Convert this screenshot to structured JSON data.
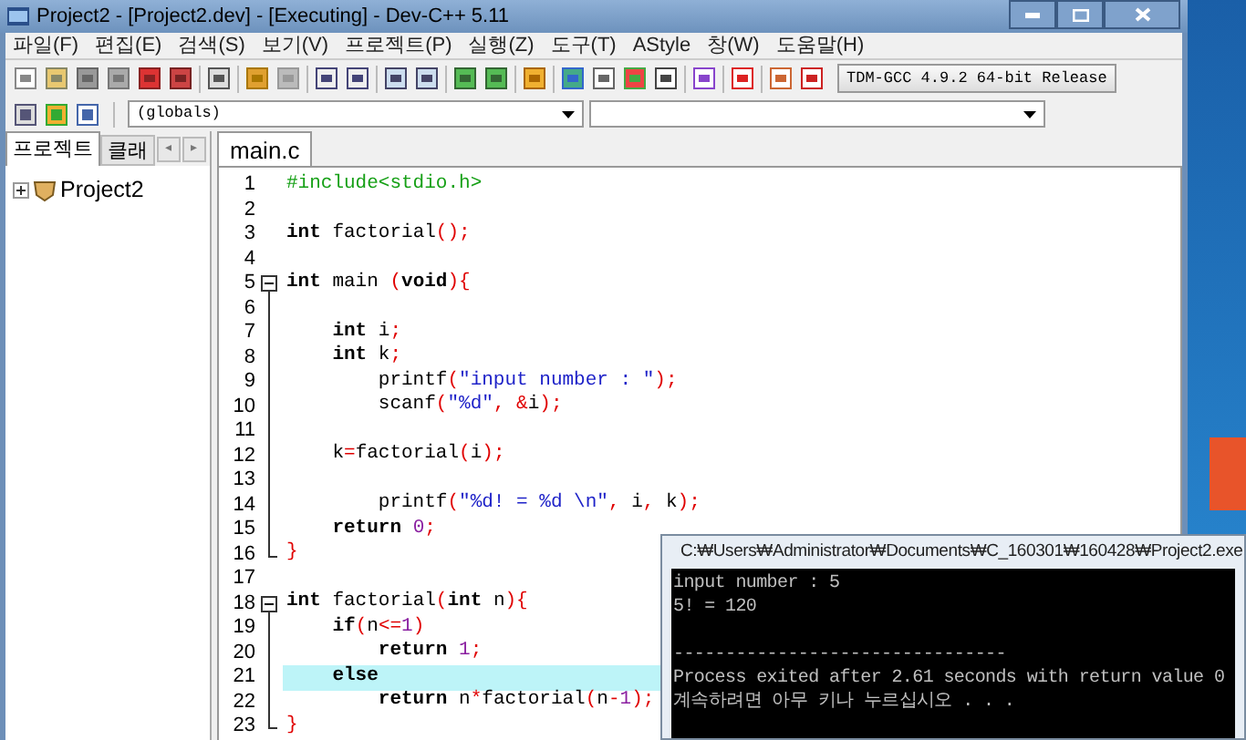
{
  "window": {
    "title": "Project2 - [Project2.dev] - [Executing] - Dev-C++ 5.11"
  },
  "menu": [
    "파일(F)",
    "편집(E)",
    "검색(S)",
    "보기(V)",
    "프로젝트(P)",
    "실행(Z)",
    "도구(T)",
    "AStyle",
    "창(W)",
    "도움말(H)"
  ],
  "compiler": {
    "value": "TDM-GCC 4.9.2 64-bit Release"
  },
  "scope": {
    "value": "(globals)"
  },
  "left_tabs": [
    {
      "label": "프로젝트",
      "selected": true
    },
    {
      "label": "클래",
      "selected": false
    }
  ],
  "left_tab_arrows": [
    "◂",
    "▸"
  ],
  "project_tree": [
    {
      "label": "Project2",
      "expanded": false
    }
  ],
  "editor_tabs": [
    {
      "label": "main.c",
      "selected": true
    }
  ],
  "code_lines": [
    {
      "number": "1",
      "kind": "plain",
      "highlighted": false,
      "tokens": [
        {
          "kind": "preproc",
          "text": "#include<stdio.h>"
        }
      ]
    },
    {
      "number": "2",
      "kind": "plain",
      "highlighted": false
    },
    {
      "number": "3",
      "kind": "plain",
      "highlighted": false,
      "tokens": [
        {
          "kind": "keyword",
          "text": "int"
        },
        {
          "kind": "plain",
          "text": " factorial"
        },
        {
          "kind": "symbol",
          "text": "();"
        }
      ]
    },
    {
      "number": "4",
      "kind": "plain",
      "highlighted": false
    },
    {
      "number": "5",
      "kind": "fold_start",
      "highlighted": false,
      "tokens": [
        {
          "kind": "keyword",
          "text": "int"
        },
        {
          "kind": "plain",
          "text": " main "
        },
        {
          "kind": "symbol",
          "text": "("
        },
        {
          "kind": "keyword",
          "text": "void"
        },
        {
          "kind": "symbol",
          "text": "){"
        }
      ]
    },
    {
      "number": "6",
      "kind": "fold_body",
      "highlighted": false
    },
    {
      "number": "7",
      "kind": "fold_body",
      "highlighted": false,
      "tokens": [
        {
          "kind": "keyword",
          "text": "    int"
        },
        {
          "kind": "plain",
          "text": " i"
        },
        {
          "kind": "symbol",
          "text": ";"
        }
      ]
    },
    {
      "number": "8",
      "kind": "fold_body",
      "highlighted": false,
      "tokens": [
        {
          "kind": "keyword",
          "text": "    int"
        },
        {
          "kind": "plain",
          "text": " k"
        },
        {
          "kind": "symbol",
          "text": ";"
        }
      ]
    },
    {
      "number": "9",
      "kind": "fold_body",
      "highlighted": false,
      "tokens": [
        {
          "kind": "plain",
          "text": "        printf"
        },
        {
          "kind": "symbol",
          "text": "("
        },
        {
          "kind": "string",
          "text": "\"input number : \""
        },
        {
          "kind": "symbol",
          "text": ");"
        }
      ]
    },
    {
      "number": "10",
      "kind": "fold_body",
      "highlighted": false,
      "tokens": [
        {
          "kind": "plain",
          "text": "        scanf"
        },
        {
          "kind": "symbol",
          "text": "("
        },
        {
          "kind": "string",
          "text": "\"%d\""
        },
        {
          "kind": "symbol",
          "text": ", &"
        },
        {
          "kind": "plain",
          "text": "i"
        },
        {
          "kind": "symbol",
          "text": ");"
        }
      ]
    },
    {
      "number": "11",
      "kind": "fold_body",
      "highlighted": false
    },
    {
      "number": "12",
      "kind": "fold_body",
      "highlighted": false,
      "tokens": [
        {
          "kind": "plain",
          "text": "    k"
        },
        {
          "kind": "symbol",
          "text": "="
        },
        {
          "kind": "plain",
          "text": "factorial"
        },
        {
          "kind": "symbol",
          "text": "("
        },
        {
          "kind": "plain",
          "text": "i"
        },
        {
          "kind": "symbol",
          "text": ");"
        }
      ]
    },
    {
      "number": "13",
      "kind": "fold_body",
      "highlighted": false
    },
    {
      "number": "14",
      "kind": "fold_body",
      "highlighted": false,
      "tokens": [
        {
          "kind": "plain",
          "text": "        printf"
        },
        {
          "kind": "symbol",
          "text": "("
        },
        {
          "kind": "string",
          "text": "\"%d! = %d \\n\""
        },
        {
          "kind": "symbol",
          "text": ", "
        },
        {
          "kind": "plain",
          "text": "i"
        },
        {
          "kind": "symbol",
          "text": ", "
        },
        {
          "kind": "plain",
          "text": "k"
        },
        {
          "kind": "symbol",
          "text": ");"
        }
      ]
    },
    {
      "number": "15",
      "kind": "fold_body",
      "highlighted": false,
      "tokens": [
        {
          "kind": "keyword",
          "text": "    return"
        },
        {
          "kind": "number",
          "text": " 0"
        },
        {
          "kind": "symbol",
          "text": ";"
        }
      ]
    },
    {
      "number": "16",
      "kind": "fold_end",
      "highlighted": false,
      "tokens": [
        {
          "kind": "symbol",
          "text": "}"
        }
      ]
    },
    {
      "number": "17",
      "kind": "plain",
      "highlighted": false
    },
    {
      "number": "18",
      "kind": "fold_start",
      "highlighted": false,
      "tokens": [
        {
          "kind": "keyword",
          "text": "int"
        },
        {
          "kind": "plain",
          "text": " factorial"
        },
        {
          "kind": "symbol",
          "text": "("
        },
        {
          "kind": "keyword",
          "text": "int"
        },
        {
          "kind": "plain",
          "text": " n"
        },
        {
          "kind": "symbol",
          "text": "){"
        }
      ]
    },
    {
      "number": "19",
      "kind": "fold_body",
      "highlighted": false,
      "tokens": [
        {
          "kind": "keyword",
          "text": "    if"
        },
        {
          "kind": "symbol",
          "text": "("
        },
        {
          "kind": "plain",
          "text": "n"
        },
        {
          "kind": "symbol",
          "text": "<="
        },
        {
          "kind": "number",
          "text": "1"
        },
        {
          "kind": "symbol",
          "text": ")"
        }
      ]
    },
    {
      "number": "20",
      "kind": "fold_body",
      "highlighted": false,
      "tokens": [
        {
          "kind": "keyword",
          "text": "        return"
        },
        {
          "kind": "number",
          "text": " 1"
        },
        {
          "kind": "symbol",
          "text": ";"
        }
      ]
    },
    {
      "number": "21",
      "kind": "fold_body",
      "highlighted": true,
      "tokens": [
        {
          "kind": "keyword",
          "text": "    else"
        }
      ]
    },
    {
      "number": "22",
      "kind": "fold_body",
      "highlighted": false,
      "tokens": [
        {
          "kind": "keyword",
          "text": "        return"
        },
        {
          "kind": "plain",
          "text": " n"
        },
        {
          "kind": "symbol",
          "text": "*"
        },
        {
          "kind": "plain",
          "text": "factorial"
        },
        {
          "kind": "symbol",
          "text": "("
        },
        {
          "kind": "plain",
          "text": "n"
        },
        {
          "kind": "symbol",
          "text": "-"
        },
        {
          "kind": "number",
          "text": "1"
        },
        {
          "kind": "symbol",
          "text": ");"
        }
      ]
    },
    {
      "number": "23",
      "kind": "fold_end",
      "highlighted": false,
      "tokens": [
        {
          "kind": "symbol",
          "text": "}"
        }
      ]
    }
  ],
  "console": {
    "title": "C:₩Users₩Administrator₩Documents₩C_160301₩160428₩Project2.exe",
    "lines": [
      {
        "kind": "output",
        "text": "input number : 5"
      },
      {
        "kind": "output",
        "text": "5! = 120"
      },
      {
        "kind": "separator",
        "text": "--------------------------------"
      },
      {
        "kind": "output",
        "text": "Process exited after 2.61 seconds with return value 0"
      },
      {
        "kind": "output",
        "text": "계속하려면 아무 키나 누르십시오 . . ."
      }
    ]
  }
}
